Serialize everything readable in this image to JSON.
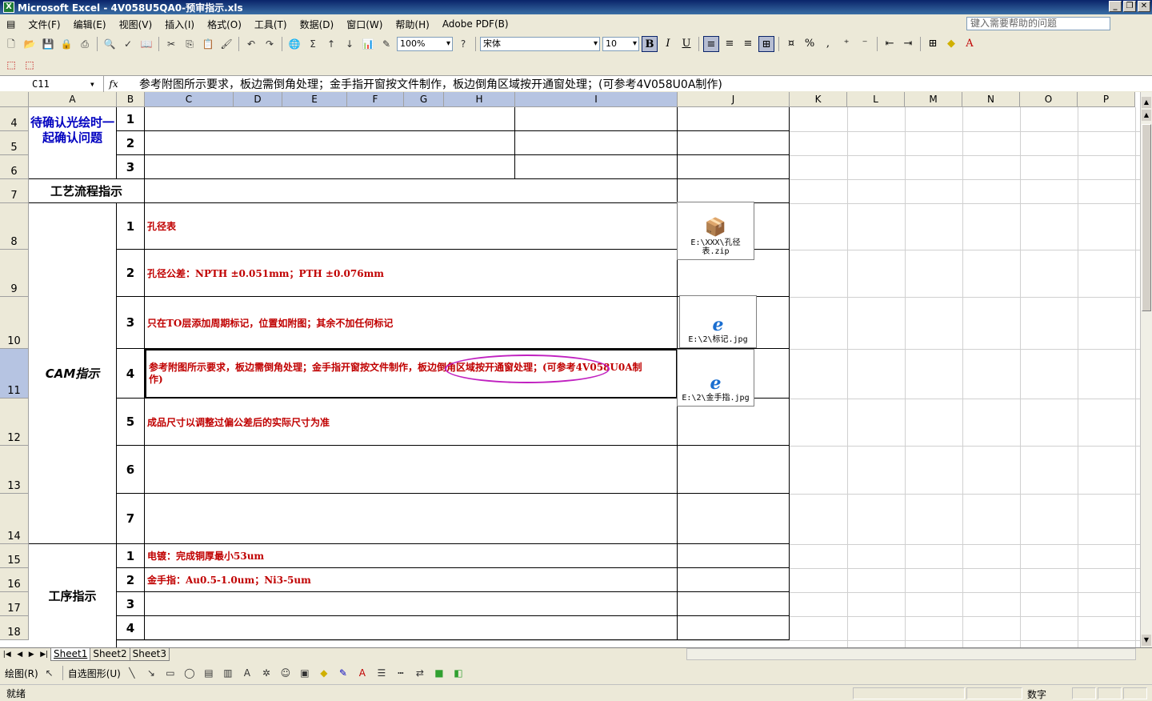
{
  "window": {
    "title": "Microsoft Excel - 4V058U5QA0-预审指示.xls",
    "app_icon": "excel-icon"
  },
  "menu": {
    "items": [
      "文件(F)",
      "编辑(E)",
      "视图(V)",
      "插入(I)",
      "格式(O)",
      "工具(T)",
      "数据(D)",
      "窗口(W)",
      "帮助(H)",
      "Adobe PDF(B)"
    ],
    "help_placeholder": "键入需要帮助的问题"
  },
  "toolbar": {
    "zoom": "100%",
    "font": "宋体",
    "size": "10",
    "bold": "B",
    "italic": "I",
    "underline": "U",
    "percent": "%",
    "comma": ","
  },
  "formula_bar": {
    "name_box": "C11",
    "fx": "fx",
    "content": "参考附图所示要求，板边需倒角处理；金手指开窗按文件制作，板边倒角区域按开通窗处理；(可参考4V058U0A制作)"
  },
  "columns": [
    "A",
    "B",
    "C",
    "D",
    "E",
    "F",
    "G",
    "H",
    "I",
    "J",
    "K",
    "L",
    "M",
    "N",
    "O",
    "P"
  ],
  "rows": [
    "4",
    "5",
    "6",
    "7",
    "8",
    "9",
    "10",
    "11",
    "12",
    "13",
    "14",
    "15",
    "16",
    "17",
    "18"
  ],
  "sheet": {
    "confirm_group": "待确认光绘时一起确认问题",
    "confirm_nums": [
      "1",
      "2",
      "3"
    ],
    "process_title": "工艺流程指示",
    "cam_group": "CAM指示",
    "cam_nums": [
      "1",
      "2",
      "3",
      "4",
      "5",
      "6",
      "7"
    ],
    "cam_items": [
      "孔径表",
      "孔径公差：NPTH ±0.051mm；PTH ±0.076mm",
      "只在TO层添加周期标记，位置如附图；其余不加任何标记",
      "参考附图所示要求，板边需倒角处理；金手指开窗按文件制作，板边倒角区域按开通窗处理；(可参考4V058U0A制作)",
      "成品尺寸以调整过偏公差后的实际尺寸为准",
      "",
      ""
    ],
    "process_group": "工序指示",
    "process_nums": [
      "1",
      "2",
      "3",
      "4"
    ],
    "process_items": [
      "电镀：完成铜厚最小53um",
      "金手指：Au0.5-1.0um；Ni3-5um",
      "",
      ""
    ]
  },
  "objects": [
    {
      "label": "E:\\XXX\\孔径表.zip",
      "icon": "zip-package-icon"
    },
    {
      "label": "E:\\2\\标记.jpg",
      "icon": "ie-file-icon"
    },
    {
      "label": "E:\\2\\金手指.jpg",
      "icon": "ie-file-icon"
    }
  ],
  "sheet_tabs": [
    "Sheet1",
    "Sheet2",
    "Sheet3"
  ],
  "drawing_bar": {
    "draw": "绘图(R)",
    "autoshapes": "自选图形(U)"
  },
  "status": {
    "ready": "就绪",
    "numlock": "数字"
  }
}
